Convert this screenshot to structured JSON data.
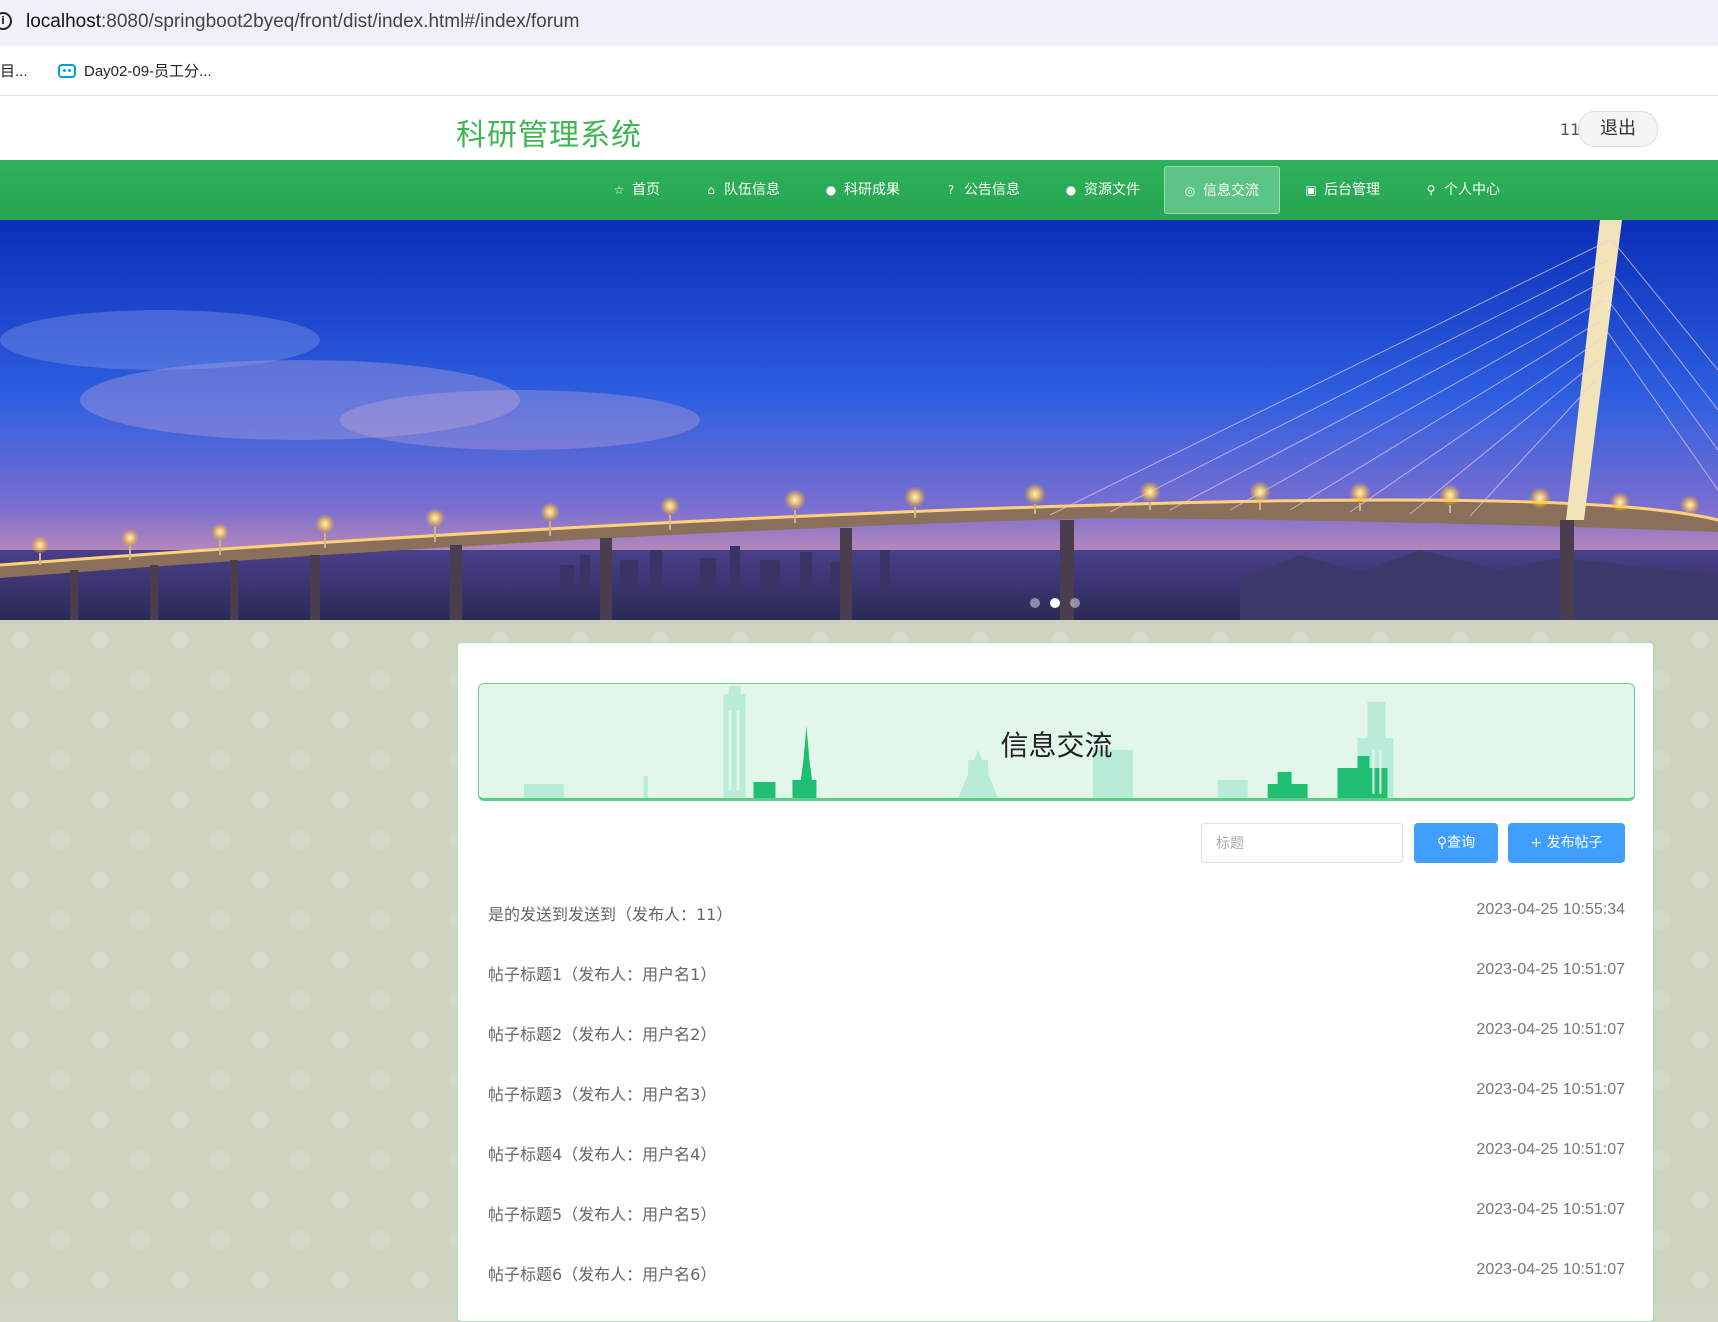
{
  "browser": {
    "url_host": "localhost",
    "url_path": ":8080/springboot2byeq/front/dist/index.html#/index/forum",
    "bookmarks": [
      "目...",
      "Day02-09-员工分..."
    ]
  },
  "header": {
    "site_title": "科研管理系统",
    "user_name": "11",
    "logout_label": "退出"
  },
  "nav": {
    "items": [
      {
        "label": "首页",
        "icon": "☆",
        "icon_name": "star-icon"
      },
      {
        "label": "队伍信息",
        "icon": "⌂",
        "icon_name": "bag-icon"
      },
      {
        "label": "科研成果",
        "icon": "●",
        "icon_name": "info-icon"
      },
      {
        "label": "公告信息",
        "icon": "?",
        "icon_name": "question-icon"
      },
      {
        "label": "资源文件",
        "icon": "●",
        "icon_name": "info-icon"
      },
      {
        "label": "信息交流",
        "icon": "◎",
        "icon_name": "globe-icon"
      },
      {
        "label": "后台管理",
        "icon": "▣",
        "icon_name": "box-icon"
      },
      {
        "label": "个人中心",
        "icon": "⚲",
        "icon_name": "user-icon"
      }
    ],
    "active_index": 5
  },
  "carousel": {
    "slide_count": 3,
    "active_index": 1
  },
  "forum": {
    "page_title": "信息交流",
    "search_placeholder": "标题",
    "search_button": "查询",
    "search_icon": "⚲",
    "add_button": "发布帖子",
    "add_icon": "+",
    "posts": [
      {
        "title": "是的发送到发送到（发布人：11）",
        "time": "2023-04-25 10:55:34"
      },
      {
        "title": "帖子标题1（发布人：用户名1）",
        "time": "2023-04-25 10:51:07"
      },
      {
        "title": "帖子标题2（发布人：用户名2）",
        "time": "2023-04-25 10:51:07"
      },
      {
        "title": "帖子标题3（发布人：用户名3）",
        "time": "2023-04-25 10:51:07"
      },
      {
        "title": "帖子标题4（发布人：用户名4）",
        "time": "2023-04-25 10:51:07"
      },
      {
        "title": "帖子标题5（发布人：用户名5）",
        "time": "2023-04-25 10:51:07"
      },
      {
        "title": "帖子标题6（发布人：用户名6）",
        "time": "2023-04-25 10:51:07"
      }
    ]
  },
  "colors": {
    "brand_green": "#3fb553",
    "nav_green": "#2db25a",
    "button_blue": "#409eff"
  }
}
